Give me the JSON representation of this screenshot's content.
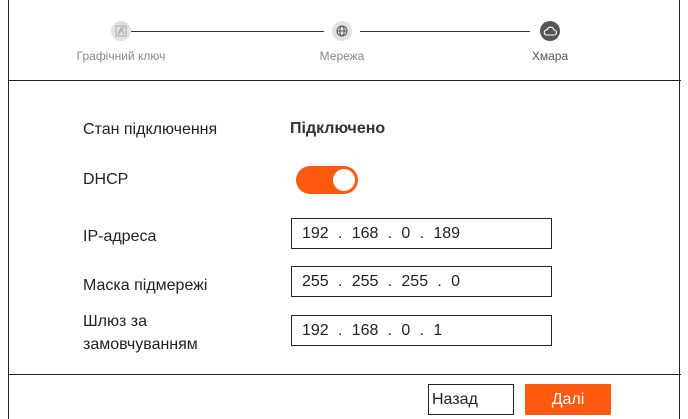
{
  "wizard": {
    "steps": [
      {
        "label": "Графічний ключ",
        "state": "done",
        "icon": "pattern-lock-icon"
      },
      {
        "label": "Мережа",
        "state": "done",
        "icon": "globe-icon"
      },
      {
        "label": "Хмара",
        "state": "active",
        "icon": "cloud-icon"
      }
    ]
  },
  "form": {
    "status": {
      "label": "Стан підключення",
      "value": "Підключено"
    },
    "dhcp": {
      "label": "DHCP",
      "enabled": true
    },
    "ip": {
      "label": "IP-адреса",
      "octets": [
        "192",
        "168",
        "0",
        "189"
      ]
    },
    "mask": {
      "label": "Маска підмережі",
      "octets": [
        "255",
        "255",
        "255",
        "0"
      ]
    },
    "gateway": {
      "label_line1": "Шлюз за",
      "label_line2": "замовчуванням",
      "octets": [
        "192",
        "168",
        "0",
        "1"
      ]
    }
  },
  "footer": {
    "back_label": "Назад",
    "next_label": "Далі"
  },
  "colors": {
    "accent": "#ff5a0f",
    "step_active": "#555555",
    "step_done": "#e2e2e2"
  }
}
